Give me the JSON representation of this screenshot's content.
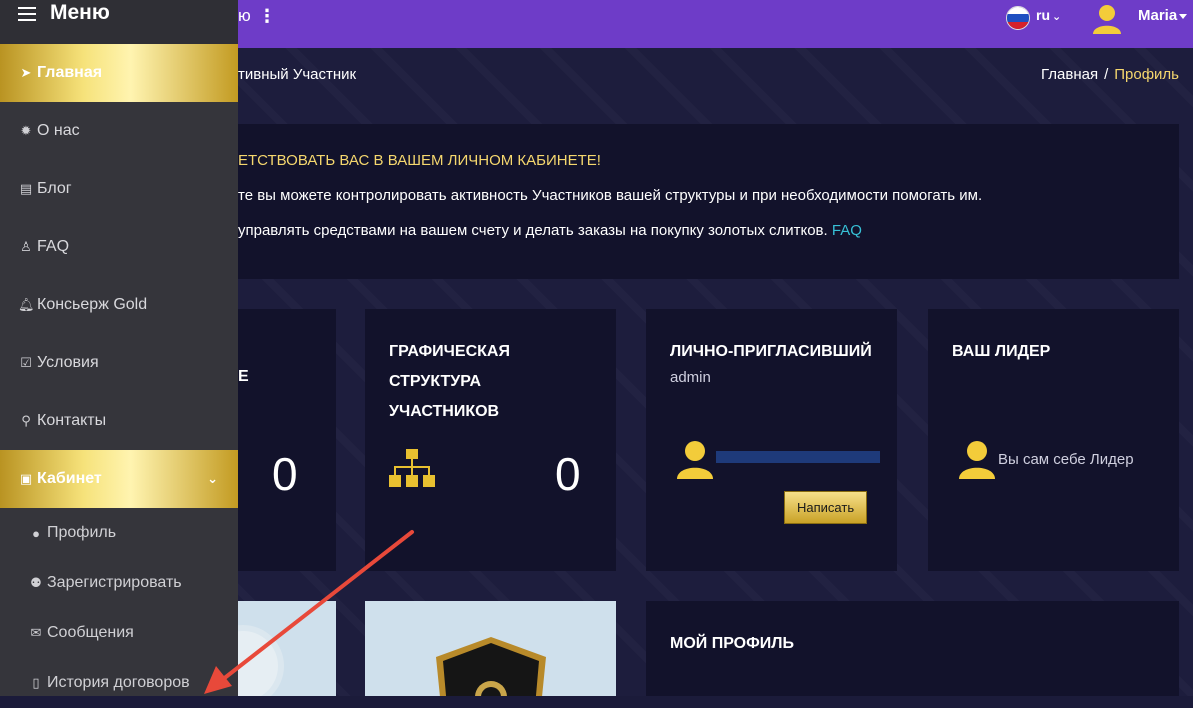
{
  "topbar": {
    "title_fragment": "ю",
    "kebab": "⋮",
    "lang": "ru",
    "user": "Maria"
  },
  "sidebar": {
    "menu_label": "Меню",
    "items": [
      {
        "label": "Главная",
        "icon": "paper-plane-icon",
        "glyph": "➤"
      },
      {
        "label": "О нас",
        "icon": "gear-icon",
        "glyph": "✹"
      },
      {
        "label": "Блог",
        "icon": "newspaper-icon",
        "glyph": "▤"
      },
      {
        "label": "FAQ",
        "icon": "person-icon",
        "glyph": "♙"
      },
      {
        "label": "Консьерж Gold",
        "icon": "bell-icon",
        "glyph": "🔔︎"
      },
      {
        "label": "Условия",
        "icon": "checkbox-icon",
        "glyph": "☑"
      },
      {
        "label": "Контакты",
        "icon": "pin-icon",
        "glyph": "⚲"
      },
      {
        "label": "Кабинет",
        "icon": "briefcase-icon",
        "glyph": "▣"
      }
    ],
    "cabinet_chevron": "⌄",
    "sub_items": [
      {
        "label": "Профиль",
        "icon": "user-icon",
        "glyph": "●"
      },
      {
        "label": "Зарегистрировать",
        "icon": "users-icon",
        "glyph": "⚉"
      },
      {
        "label": "Сообщения",
        "icon": "envelope-icon",
        "glyph": "✉"
      },
      {
        "label": "История договоров",
        "icon": "file-icon",
        "glyph": "▯"
      }
    ]
  },
  "header": {
    "title_fragment": "тивный Участник",
    "breadcrumb_home": "Главная",
    "breadcrumb_sep": "/",
    "breadcrumb_current": "Профиль"
  },
  "welcome": {
    "heading": "ЕТСТВОВАТЬ ВАС В ВАШЕМ ЛИЧНОМ КАБИНЕТЕ!",
    "line1": "те вы можете контролировать активность Участников вашей структуры и при необходимости помогать им.",
    "line2": "управлять средствами на вашем счету и делать заказы на покупку золотых слитков.",
    "faq": "FAQ"
  },
  "cards": {
    "partial": {
      "title": "Е",
      "count": "0"
    },
    "structure": {
      "title_lines": [
        "ГРАФИЧЕСКАЯ",
        "СТРУКТУРА",
        "УЧАСТНИКОВ"
      ],
      "count": "0"
    },
    "inviter": {
      "title": "ЛИЧНО-ПРИГЛАСИВШИЙ",
      "name": "admin",
      "button": "Написать"
    },
    "leader": {
      "title": "ВАШ ЛИДЕР",
      "text": "Вы сам себе Лидер"
    },
    "profile": {
      "title": "МОЙ ПРОФИЛЬ"
    }
  },
  "colors": {
    "topbar": "#6e3cc8",
    "accent_gold": "#f5d76e",
    "faq_link": "#37c0d6",
    "sidebar": "#35353b",
    "arrow": "#e8493a"
  }
}
